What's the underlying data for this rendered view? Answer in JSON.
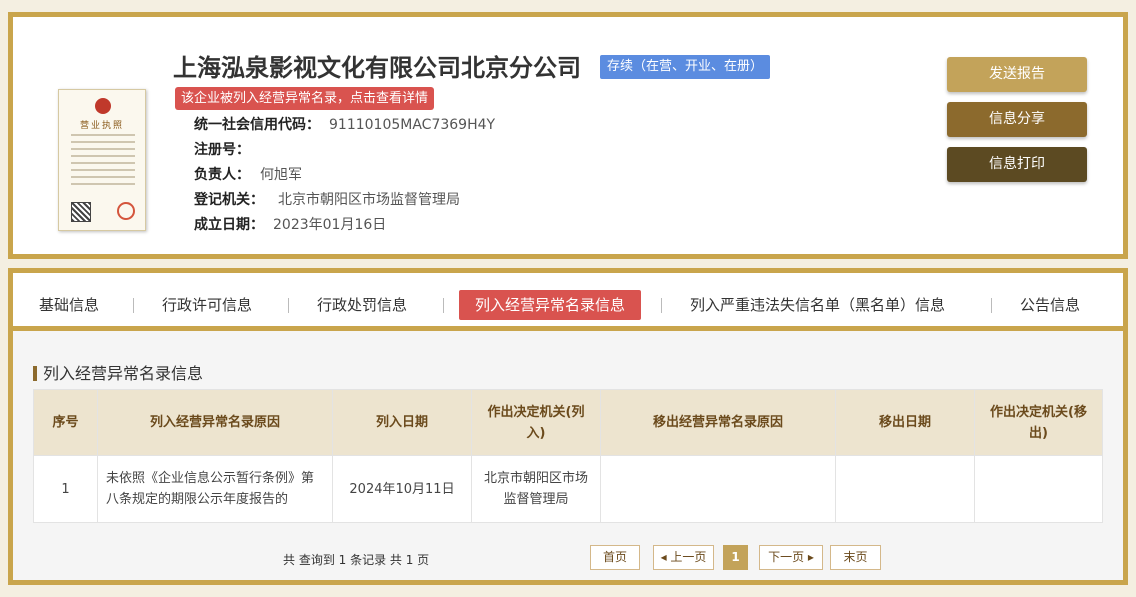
{
  "company": {
    "name": "上海泓泉影视文化有限公司北京分公司",
    "status": "存续（在营、开业、在册）",
    "abnormal_notice": "该企业被列入经营异常名录，点击查看详情",
    "license_label": "营业执照",
    "fields": [
      {
        "label": "统一社会信用代码：",
        "value": "91110105MAC7369H4Y"
      },
      {
        "label": "注册号：",
        "value": ""
      },
      {
        "label": "负责人：",
        "value": "何旭军"
      },
      {
        "label": "登记机关：",
        "value": "北京市朝阳区市场监督管理局"
      },
      {
        "label": "成立日期：",
        "value": "2023年01月16日"
      }
    ]
  },
  "actions": {
    "send_report": "发送报告",
    "share": "信息分享",
    "print": "信息打印"
  },
  "tabs": [
    {
      "label": "基础信息",
      "active": false
    },
    {
      "label": "行政许可信息",
      "active": false
    },
    {
      "label": "行政处罚信息",
      "active": false
    },
    {
      "label": "列入经营异常名录信息",
      "active": true
    },
    {
      "label": "列入严重违法失信名单（黑名单）信息",
      "active": false
    },
    {
      "label": "公告信息",
      "active": false
    }
  ],
  "section": {
    "title": "列入经营异常名录信息",
    "columns": [
      "序号",
      "列入经营异常名录原因",
      "列入日期",
      "作出决定机关(列入)",
      "移出经营异常名录原因",
      "移出日期",
      "作出决定机关(移出)"
    ],
    "rows": [
      [
        "1",
        "未依照《企业信息公示暂行条例》第八条规定的期限公示年度报告的",
        "2024年10月11日",
        "北京市朝阳区市场监督管理局",
        "",
        "",
        ""
      ]
    ]
  },
  "pagination": {
    "summary": "共 查询到 1 条记录 共 1 页",
    "first": "首页",
    "prev": "◂ 上一页",
    "current": "1",
    "next": "下一页 ▸",
    "last": "末页"
  },
  "colors": {
    "gold_border": "#c9a54c",
    "status_blue": "#5b8ce0",
    "alert_red": "#d9534f",
    "btn_send": "#c3a35a",
    "btn_share": "#8c6a2d",
    "btn_print": "#5c4a22"
  }
}
